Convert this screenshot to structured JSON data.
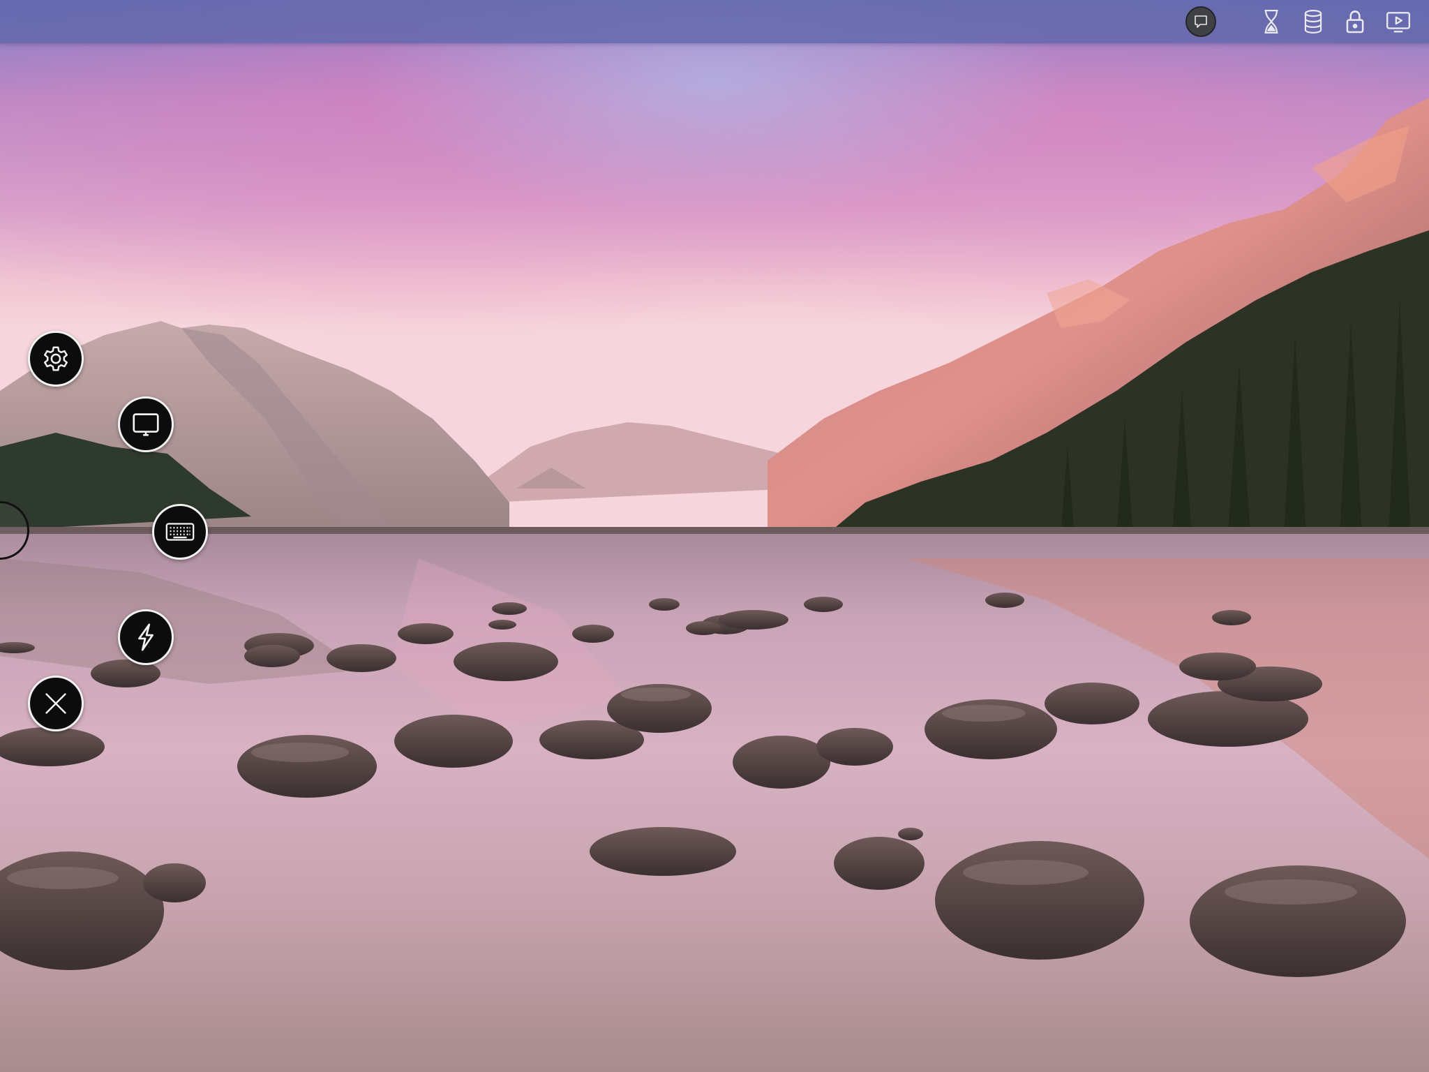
{
  "colors": {
    "top_bar": "#6066aa",
    "fab_background": "#0c0c0d",
    "fab_border": "#f2f2f2",
    "icon_stroke": "#f2f2f2"
  },
  "top_bar": {
    "icons": [
      "chat-bubble-icon",
      "hourglass-icon",
      "database-icon",
      "lock-icon",
      "cast-play-icon"
    ]
  },
  "floating_menu": {
    "buttons": [
      "gear-icon",
      "monitor-icon",
      "keyboard-icon",
      "lightning-icon",
      "close-icon"
    ]
  },
  "wallpaper": {
    "scene": "mountain-lake-sunset"
  }
}
